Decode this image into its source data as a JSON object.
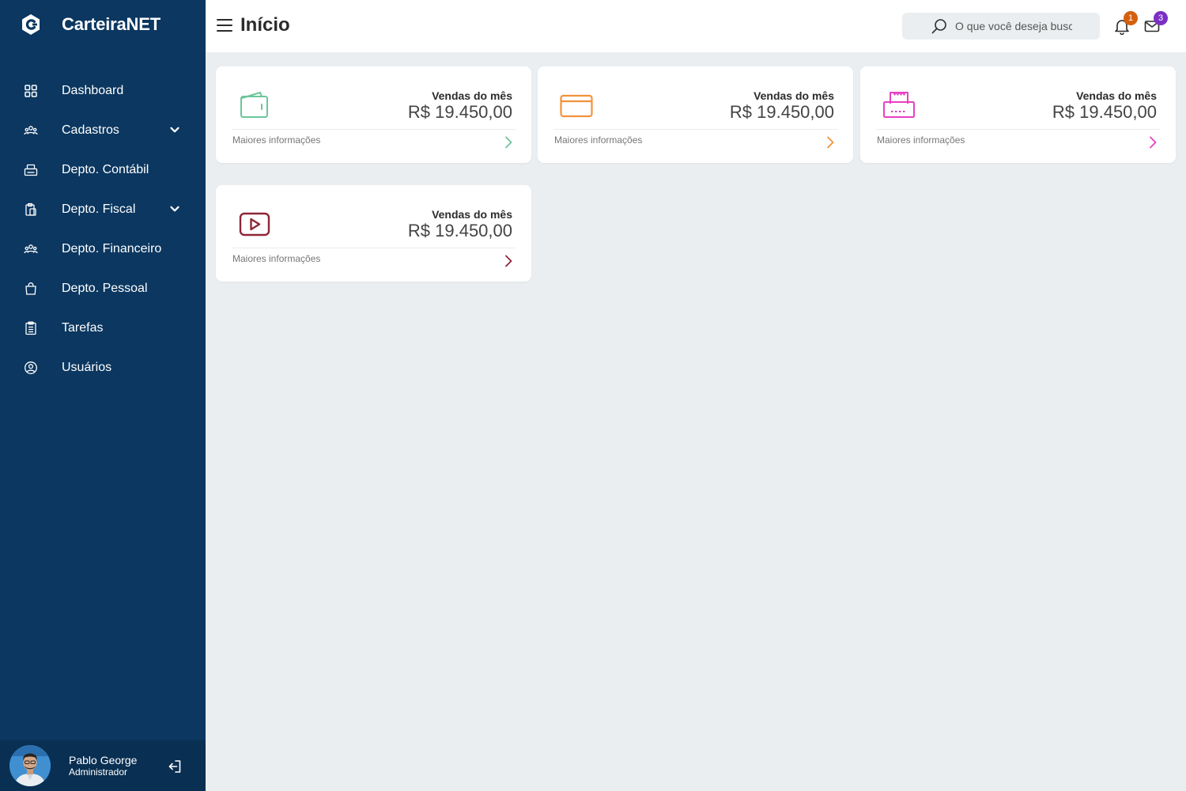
{
  "app": {
    "brand_name": "CarteiraNET",
    "brand_icon": "carteiranet-logo-icon"
  },
  "sidebar": {
    "items": [
      {
        "label": "Dashboard",
        "icon": "grid-icon",
        "has_submenu": false
      },
      {
        "label": "Cadastros",
        "icon": "users-group-icon",
        "has_submenu": true
      },
      {
        "label": "Depto. Contábil",
        "icon": "printer-icon",
        "has_submenu": false
      },
      {
        "label": "Depto. Fiscal",
        "icon": "clipboard-copy-icon",
        "has_submenu": true
      },
      {
        "label": "Depto. Financeiro",
        "icon": "users-group-icon",
        "has_submenu": false
      },
      {
        "label": "Depto. Pessoal",
        "icon": "shopping-bag-icon",
        "has_submenu": false
      },
      {
        "label": "Tarefas",
        "icon": "checklist-icon",
        "has_submenu": false
      },
      {
        "label": "Usuários",
        "icon": "user-circle-icon",
        "has_submenu": false
      }
    ]
  },
  "user": {
    "name": "Pablo George",
    "role": "Administrador"
  },
  "header": {
    "title": "Início",
    "search_placeholder": "O que você deseja buscar?",
    "notifications_count": "1",
    "messages_count": "3"
  },
  "cards": [
    {
      "title": "Vendas do mês",
      "value": "R$ 19.450,00",
      "link": "Maiores informações",
      "icon": "wallet-icon",
      "color": "#6cc59a"
    },
    {
      "title": "Vendas do mês",
      "value": "R$ 19.450,00",
      "link": "Maiores informações",
      "icon": "credit-card-icon",
      "color": "#f4923a"
    },
    {
      "title": "Vendas do mês",
      "value": "R$ 19.450,00",
      "link": "Maiores informações",
      "icon": "printer-icon",
      "color": "#e83fc4"
    },
    {
      "title": "Vendas do mês",
      "value": "R$ 19.450,00",
      "link": "Maiores informações",
      "icon": "video-play-icon",
      "color": "#8e2638"
    }
  ],
  "colors": {
    "sidebar_bg": "#0b3760",
    "content_bg": "#ebeef0",
    "notification_badge": "#d4600f",
    "message_badge": "#7b2fc4"
  }
}
